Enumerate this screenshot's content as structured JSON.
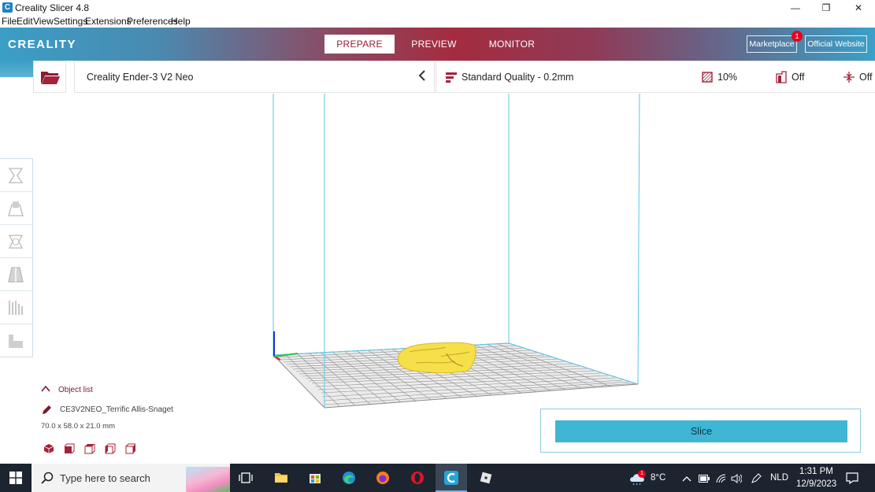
{
  "window": {
    "title": "Creality Slicer 4.8",
    "app_icon_letter": "C",
    "minimize": "—",
    "maximize": "❐",
    "close": "✕"
  },
  "menu": [
    "File",
    "Edit",
    "View",
    "Settings",
    "Extensions",
    "Preferences",
    "Help"
  ],
  "header": {
    "logo": "CREALITY",
    "tabs": [
      {
        "label": "PREPARE",
        "active": true
      },
      {
        "label": "PREVIEW",
        "active": false
      },
      {
        "label": "MONITOR",
        "active": false
      }
    ],
    "marketplace": "Marketplace",
    "marketplace_badge": "1",
    "official_website": "Official Website"
  },
  "toolbar": {
    "printer": "Creality Ender-3 V2 Neo",
    "quality": "Standard Quality - 0.2mm",
    "infill": "10%",
    "support": "Off",
    "adhesion": "Off"
  },
  "object_list": {
    "header": "Object list",
    "object_name": "CE3V2NEO_Terrific Allis-Snaget",
    "dimensions": "70.0 x 58.0 x 21.0 mm"
  },
  "slice": {
    "label": "Slice"
  },
  "taskbar": {
    "search_placeholder": "Type here to search",
    "weather_temp": "8°C",
    "weather_badge": "1",
    "language": "NLD",
    "time": "1:31 PM",
    "date": "12/9/2023"
  },
  "colors": {
    "accent_red": "#a01e35",
    "slice_button": "#3fb6d4",
    "build_volume_line": "#5bc7e6",
    "model_yellow": "#f5e04a"
  }
}
